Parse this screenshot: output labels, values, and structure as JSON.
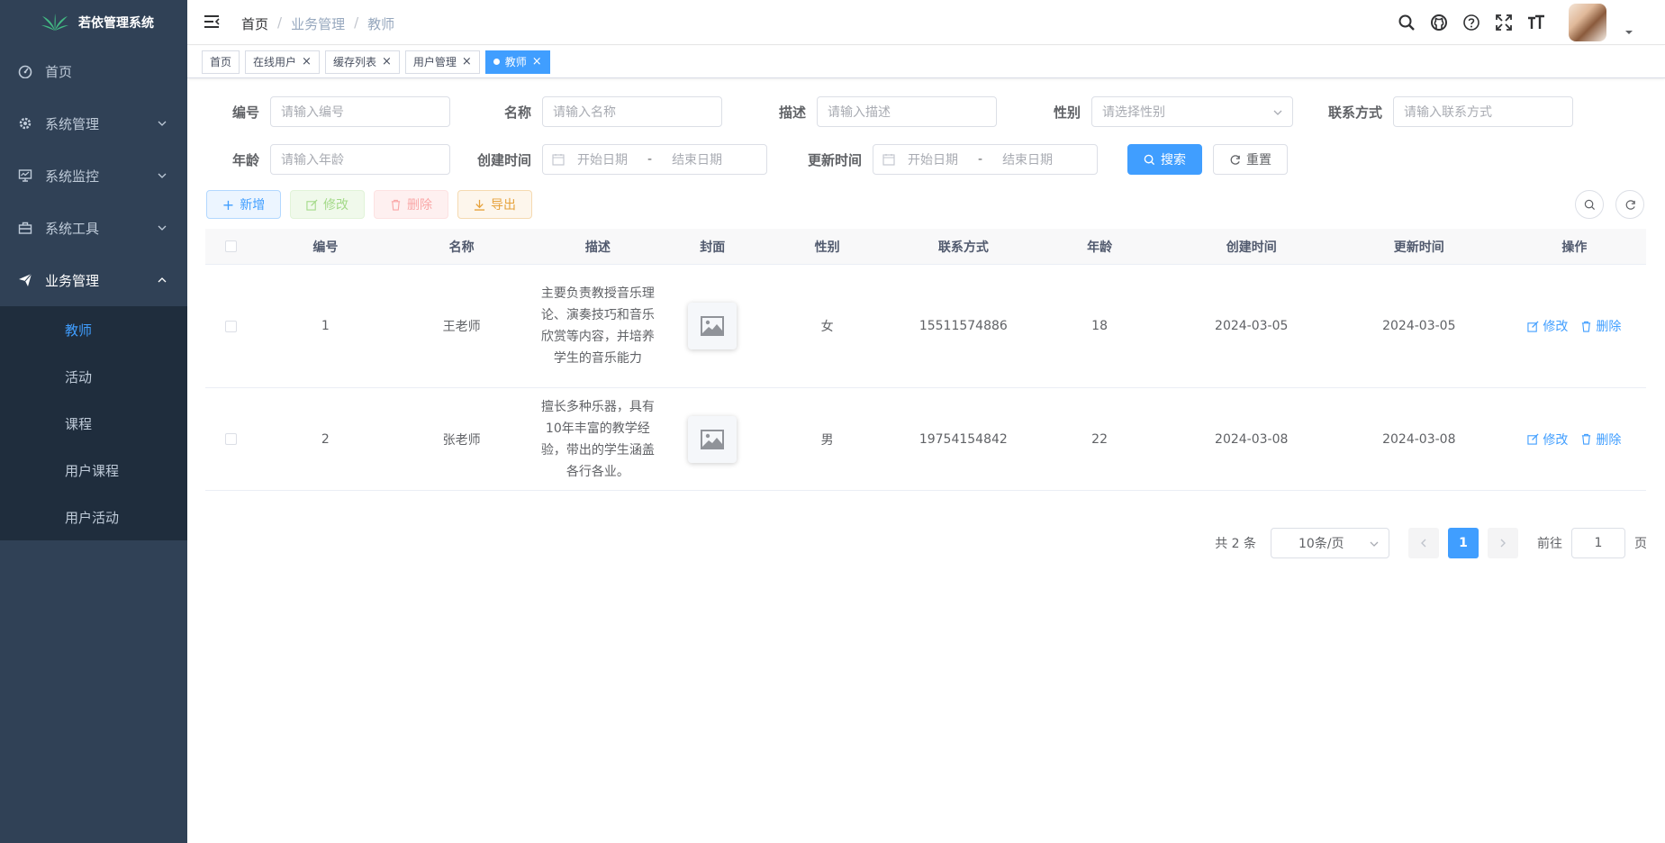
{
  "app": {
    "title": "若依管理系统"
  },
  "sidebar": {
    "items": [
      {
        "label": "首页",
        "icon": "dashboard-icon"
      },
      {
        "label": "系统管理",
        "icon": "gear-icon"
      },
      {
        "label": "系统监控",
        "icon": "monitor-icon"
      },
      {
        "label": "系统工具",
        "icon": "toolbox-icon"
      },
      {
        "label": "业务管理",
        "icon": "paper-plane-icon"
      }
    ],
    "submenu": [
      {
        "label": "教师",
        "active": true
      },
      {
        "label": "活动"
      },
      {
        "label": "课程"
      },
      {
        "label": "用户课程"
      },
      {
        "label": "用户活动"
      }
    ]
  },
  "navbar": {
    "breadcrumb": [
      "首页",
      "业务管理",
      "教师"
    ],
    "separator": "/"
  },
  "tags": [
    {
      "label": "首页"
    },
    {
      "label": "在线用户",
      "close": "×"
    },
    {
      "label": "缓存列表",
      "close": "×"
    },
    {
      "label": "用户管理",
      "close": "×"
    },
    {
      "label": "教师",
      "close": "×",
      "active": true
    }
  ],
  "search_form": {
    "id_label": "编号",
    "id_placeholder": "请输入编号",
    "name_label": "名称",
    "name_placeholder": "请输入名称",
    "desc_label": "描述",
    "desc_placeholder": "请输入描述",
    "gender_label": "性别",
    "gender_placeholder": "请选择性别",
    "contact_label": "联系方式",
    "contact_placeholder": "请输入联系方式",
    "age_label": "年龄",
    "age_placeholder": "请输入年龄",
    "created_label": "创建时间",
    "updated_label": "更新时间",
    "start_date": "开始日期",
    "end_date": "结束日期",
    "range_sep": "-",
    "search_button": "搜索",
    "reset_button": "重置"
  },
  "toolbar": {
    "add": "新增",
    "edit": "修改",
    "delete": "删除",
    "export": "导出"
  },
  "table": {
    "columns": [
      "编号",
      "名称",
      "描述",
      "封面",
      "性别",
      "联系方式",
      "年龄",
      "创建时间",
      "更新时间",
      "操作"
    ],
    "rows": [
      {
        "id": "1",
        "name": "王老师",
        "desc": "主要负责教授音乐理论、演奏技巧和音乐欣赏等内容，并培养学生的音乐能力",
        "gender": "女",
        "contact": "15511574886",
        "age": "18",
        "created": "2024-03-05",
        "updated": "2024-03-05",
        "edit": "修改",
        "delete": "删除"
      },
      {
        "id": "2",
        "name": "张老师",
        "desc": "擅长多种乐器，具有10年丰富的教学经验，带出的学生涵盖各行各业。",
        "gender": "男",
        "contact": "19754154842",
        "age": "22",
        "created": "2024-03-08",
        "updated": "2024-03-08",
        "edit": "修改",
        "delete": "删除"
      }
    ]
  },
  "pagination": {
    "total": "共 2 条",
    "page_size": "10条/页",
    "current": "1",
    "jump_prefix": "前往",
    "jump_value": "1",
    "jump_suffix": "页"
  },
  "colors": {
    "sidebar_bg": "#304156",
    "submenu_bg": "#1f2d3d",
    "primary": "#409eff"
  }
}
